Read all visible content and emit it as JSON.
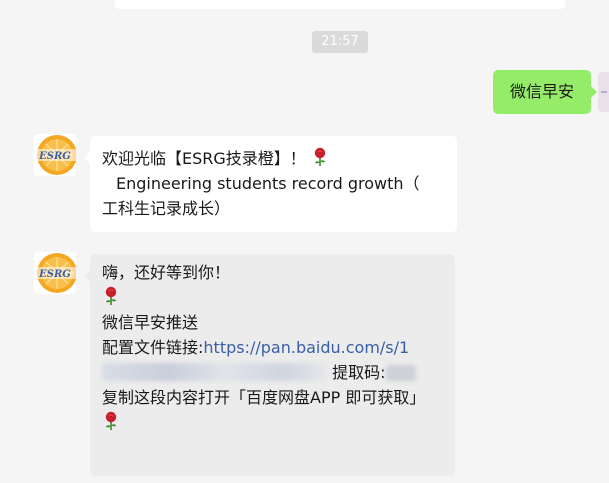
{
  "chat": {
    "timestamp": "21:57",
    "outgoing_message": "微信早安",
    "message1": {
      "line1": "欢迎光临【ESRG技录橙】！",
      "line2": "Engineering students record growth（",
      "line3": "工科生记录成长）"
    },
    "message2": {
      "line1": "嗨，还好等到你！",
      "line2": "微信早安推送",
      "line3_prefix": "配置文件链接:",
      "line3_link": "https://pan.baidu.com/s/1",
      "line4_suffix": "提取码:",
      "line5": "复制这段内容打开「百度网盘APP 即可获取」"
    },
    "avatar_logo_text": "ESRG",
    "colors": {
      "outgoing_bubble": "#95ec69",
      "background": "#f5f5f5",
      "link": "#3a5ea8",
      "avatar_orange": "#f5a623"
    },
    "icons": [
      "rose-emoji-icon",
      "esrg-logo-icon"
    ]
  }
}
